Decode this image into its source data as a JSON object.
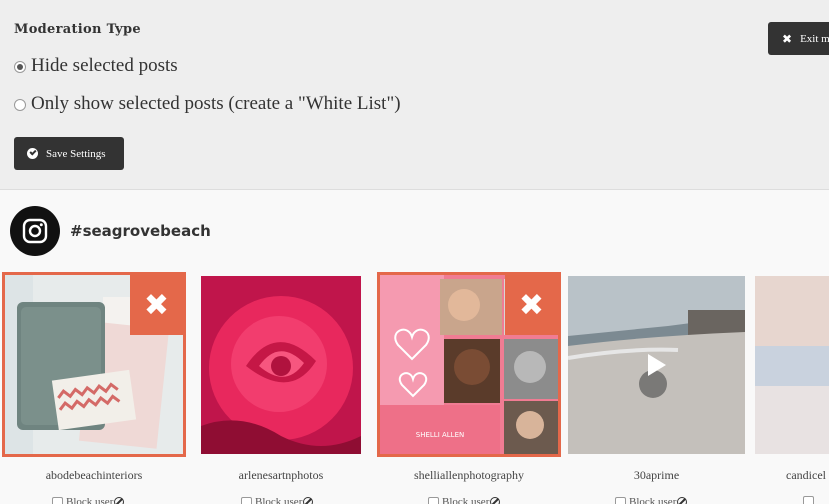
{
  "moderation": {
    "title": "Moderation Type",
    "options": [
      {
        "label": "Hide selected posts",
        "selected": true
      },
      {
        "label": "Only show selected posts (create a \"White List\")",
        "selected": false
      }
    ],
    "save_label": "Save Settings",
    "exit_label": "Exit m"
  },
  "feed": {
    "hashtag": "#seagrovebeach",
    "block_label": "Block user",
    "posts": [
      {
        "username": "abodebeachinteriors",
        "selected": true,
        "video": false
      },
      {
        "username": "arlenesartnphotos",
        "selected": false,
        "video": false
      },
      {
        "username": "shelliallenphotography",
        "selected": true,
        "video": false
      },
      {
        "username": "30aprime",
        "selected": false,
        "video": true
      },
      {
        "username": "candicel",
        "selected": false,
        "video": false
      }
    ]
  },
  "colors": {
    "accent": "#e4684a",
    "button_dark": "#333333",
    "panel": "#eeeeee"
  }
}
